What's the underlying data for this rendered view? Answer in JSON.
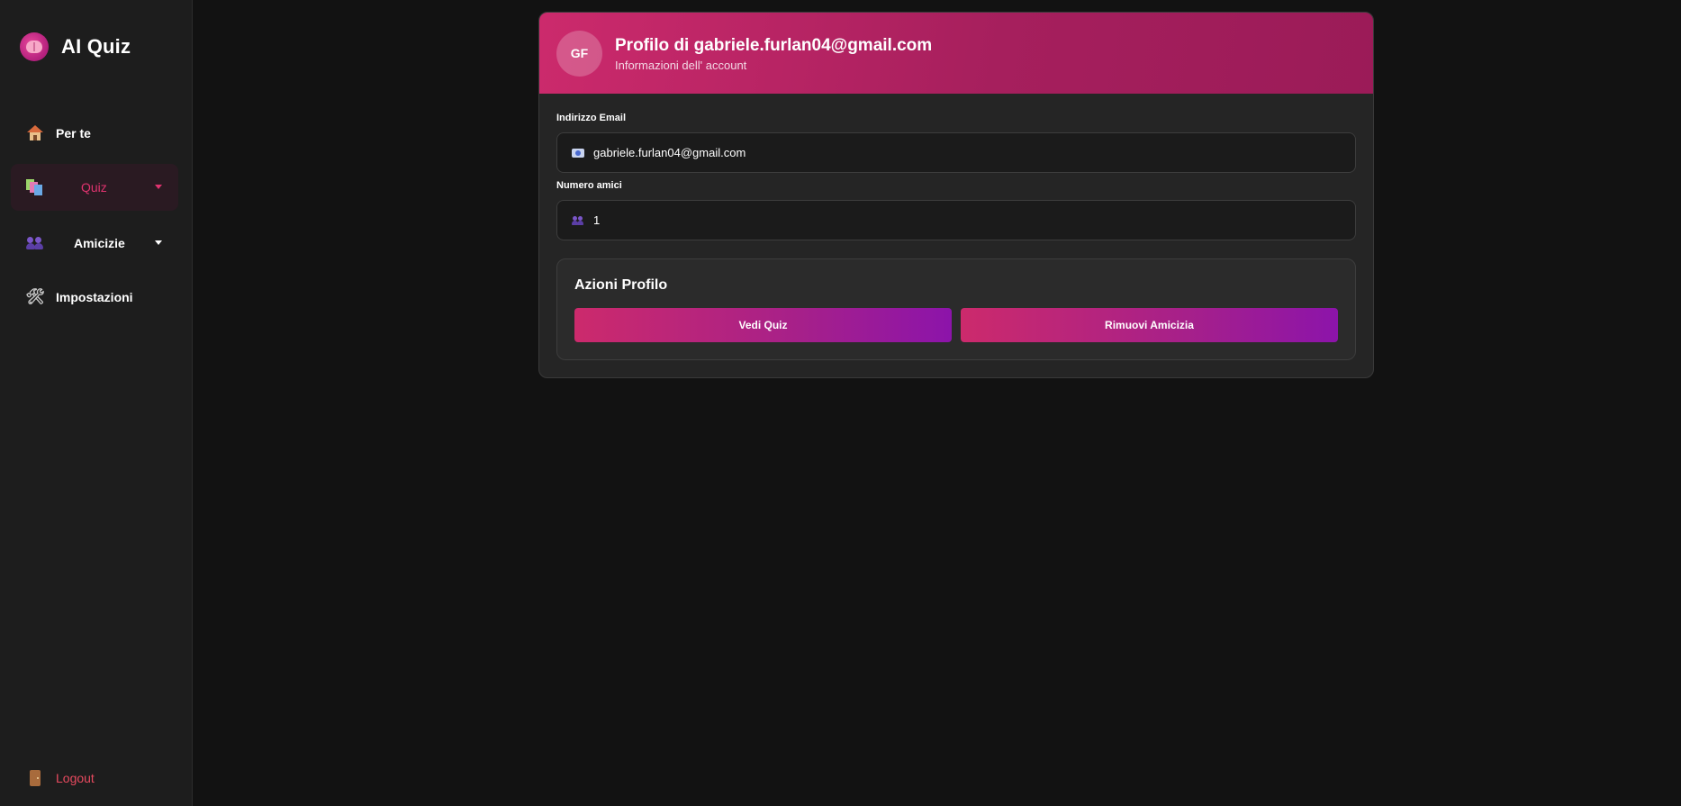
{
  "app": {
    "title": "AI Quiz"
  },
  "sidebar": {
    "items": [
      {
        "label": "Per te",
        "icon": "house-icon"
      },
      {
        "label": "Quiz",
        "icon": "books-icon"
      },
      {
        "label": "Amicizie",
        "icon": "people-icon"
      },
      {
        "label": "Impostazioni",
        "icon": "tools-icon"
      }
    ],
    "logout": {
      "label": "Logout",
      "icon": "door-icon"
    }
  },
  "profile": {
    "avatar_initials": "GF",
    "title": "Profilo di gabriele.furlan04@gmail.com",
    "subtitle": "Informazioni dell' account",
    "email_label": "Indirizzo Email",
    "email_value": "gabriele.furlan04@gmail.com",
    "friends_label": "Numero amici",
    "friends_value": "1"
  },
  "actions": {
    "title": "Azioni Profilo",
    "view_quiz_label": "Vedi Quiz",
    "remove_friend_label": "Rimuovi Amicizia"
  },
  "colors": {
    "accent": "#cc2a6c",
    "accent_end": "#8c14aa",
    "logout": "#e84a5f",
    "background": "#121212",
    "sidebar": "#1d1d1d"
  }
}
